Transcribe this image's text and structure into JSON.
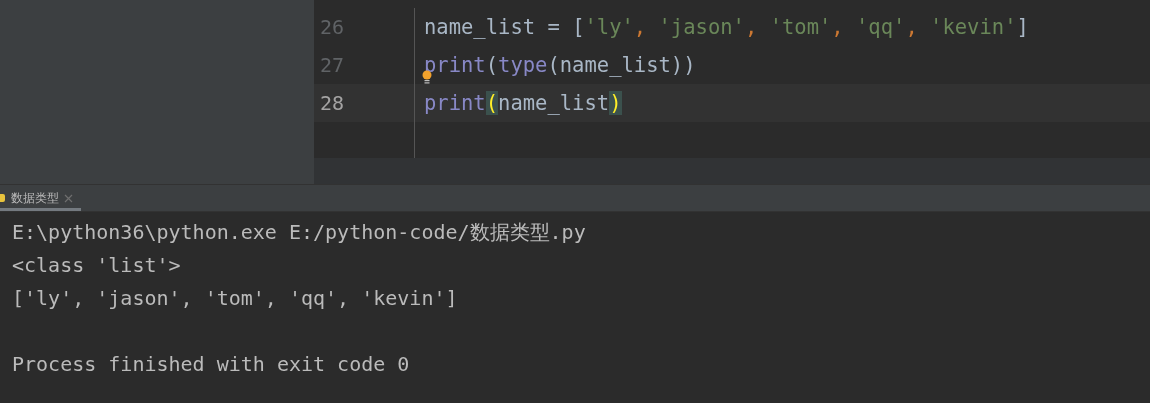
{
  "editor": {
    "lines": [
      {
        "number": "26",
        "current": false,
        "hint": false,
        "tokens": [
          {
            "text": "name_list",
            "kind": "name"
          },
          {
            "text": " = ",
            "kind": "name"
          },
          {
            "text": "[",
            "kind": "name"
          },
          {
            "text": "'ly'",
            "kind": "string"
          },
          {
            "text": ", ",
            "kind": "comma"
          },
          {
            "text": "'jason'",
            "kind": "string"
          },
          {
            "text": ", ",
            "kind": "comma"
          },
          {
            "text": "'tom'",
            "kind": "string"
          },
          {
            "text": ", ",
            "kind": "comma"
          },
          {
            "text": "'qq'",
            "kind": "string"
          },
          {
            "text": ", ",
            "kind": "comma"
          },
          {
            "text": "'kevin'",
            "kind": "string"
          },
          {
            "text": "]",
            "kind": "name"
          }
        ]
      },
      {
        "number": "27",
        "current": false,
        "hint": true,
        "tokens": [
          {
            "text": "print",
            "kind": "builtin"
          },
          {
            "text": "(",
            "kind": "name"
          },
          {
            "text": "type",
            "kind": "builtin"
          },
          {
            "text": "(name_list))",
            "kind": "name"
          }
        ]
      },
      {
        "number": "28",
        "current": true,
        "hint": false,
        "tokens": [
          {
            "text": "print",
            "kind": "builtin"
          },
          {
            "text": "(",
            "kind": "brace"
          },
          {
            "text": "name_list",
            "kind": "name"
          },
          {
            "text": ")",
            "kind": "brace"
          }
        ]
      }
    ]
  },
  "run_tabs": [
    {
      "label": "数据类型",
      "selected": true
    }
  ],
  "console": [
    {
      "text": "E:\\python36\\python.exe E:/python-code/数据类型.py",
      "kind": "output"
    },
    {
      "text": "<class 'list'>",
      "kind": "output"
    },
    {
      "text": "['ly', 'jason', 'tom', 'qq', 'kevin']",
      "kind": "output"
    },
    {
      "text": "Process finished with exit code 0",
      "kind": "status"
    }
  ]
}
